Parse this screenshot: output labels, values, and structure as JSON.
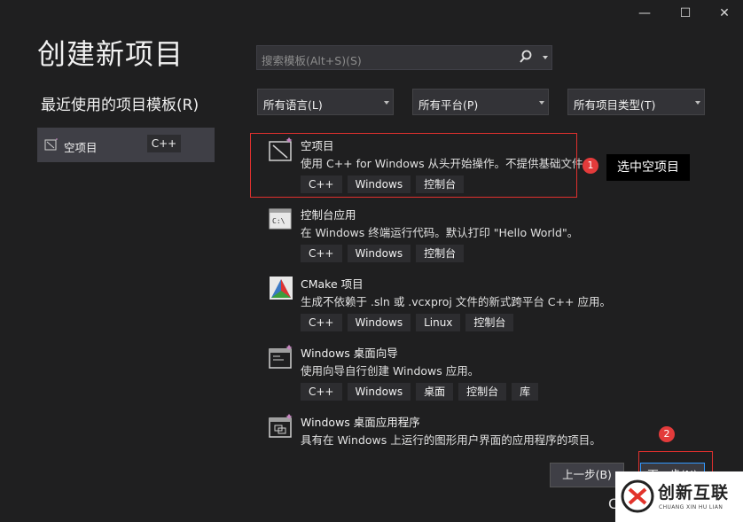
{
  "window_controls": {
    "minimize": "—",
    "maximize": "☐",
    "close": "✕"
  },
  "title": "创建新项目",
  "search": {
    "placeholder": "搜索模板(Alt+S)(S)"
  },
  "recent": {
    "title": "最近使用的项目模板(R)",
    "items": [
      {
        "label": "空项目",
        "tag": "C++"
      }
    ]
  },
  "filters": [
    {
      "label": "所有语言(L)"
    },
    {
      "label": "所有平台(P)"
    },
    {
      "label": "所有项目类型(T)"
    }
  ],
  "templates": [
    {
      "name": "空项目",
      "desc": "使用 C++ for Windows 从头开始操作。不提供基础文件。",
      "tags": [
        "C++",
        "Windows",
        "控制台"
      ],
      "icon": "empty-project-icon"
    },
    {
      "name": "控制台应用",
      "desc": "在 Windows 终端运行代码。默认打印 \"Hello World\"。",
      "tags": [
        "C++",
        "Windows",
        "控制台"
      ],
      "icon": "console-app-icon"
    },
    {
      "name": "CMake 项目",
      "desc": "生成不依赖于 .sln 或 .vcxproj 文件的新式跨平台 C++ 应用。",
      "tags": [
        "C++",
        "Windows",
        "Linux",
        "控制台"
      ],
      "icon": "cmake-icon"
    },
    {
      "name": "Windows 桌面向导",
      "desc": "使用向导自行创建 Windows 应用。",
      "tags": [
        "C++",
        "Windows",
        "桌面",
        "控制台",
        "库"
      ],
      "icon": "desktop-wizard-icon"
    },
    {
      "name": "Windows 桌面应用程序",
      "desc": "具有在 Windows 上运行的图形用户界面的应用程序的项目。",
      "tags": [],
      "icon": "desktop-app-icon"
    }
  ],
  "annotations": {
    "badge1": "1",
    "callout": "选中空项目",
    "badge2": "2"
  },
  "buttons": {
    "back": "上一步(B)",
    "next": "下一步(N)",
    "partial": "C"
  },
  "watermark": {
    "main": "创新互联",
    "sub": "CHUANG XIN HU LIAN"
  },
  "colors": {
    "background": "#1f1f20",
    "annotation_red": "#e0302e",
    "focus_blue": "#3399ff"
  }
}
